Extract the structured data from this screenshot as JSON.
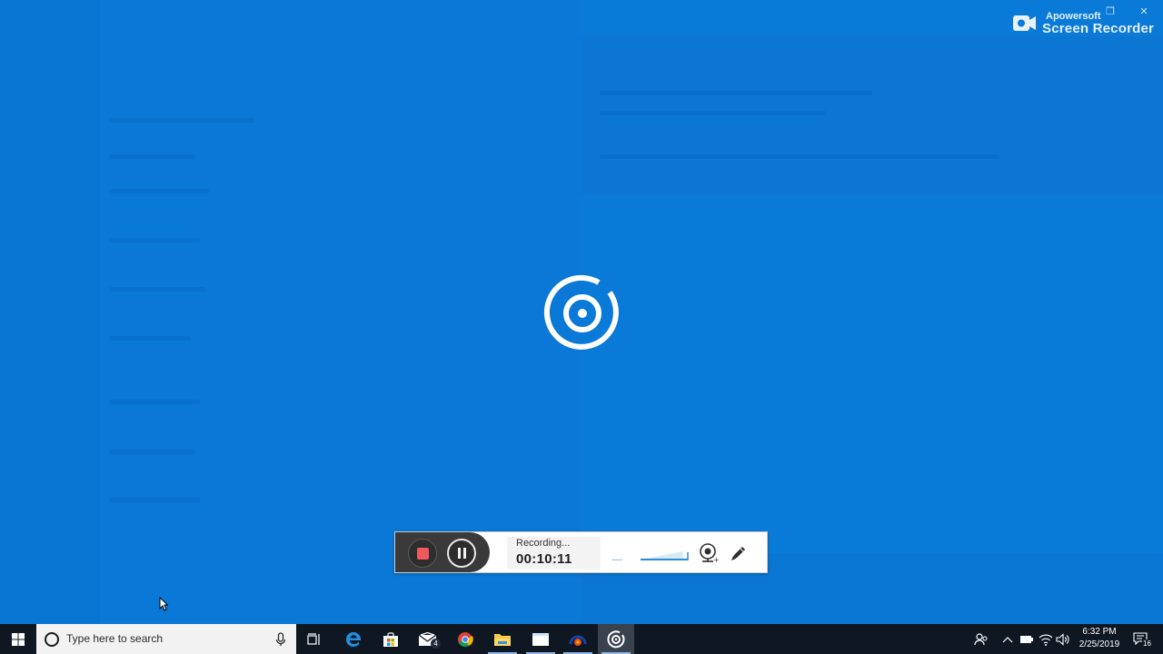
{
  "watermark": {
    "brand": "Apowersoft",
    "product": "Screen Recorder"
  },
  "recorder": {
    "status": "Recording...",
    "elapsed": "00:10:11",
    "volume_level": 0.9,
    "dots": "......"
  },
  "taskbar": {
    "search_placeholder": "Type here to search",
    "mail_badge": "4",
    "clock_time": "6:32 PM",
    "clock_date": "2/25/2019",
    "notification_count": "16"
  },
  "colors": {
    "background": "#0a7ad9",
    "taskbar": "#0f1722",
    "stop_red": "#f0595c",
    "accent": "#2a8bd8"
  },
  "icons": [
    "screen-recorder-logo-icon",
    "start-icon",
    "search-icon",
    "microphone-icon",
    "task-view-icon",
    "edge-icon",
    "store-icon",
    "mail-icon",
    "chrome-icon",
    "file-explorer-icon",
    "window-icon",
    "media-app-icon",
    "recorder-app-icon",
    "people-icon",
    "chevron-up-icon",
    "battery-icon",
    "wifi-icon",
    "volume-icon",
    "notifications-icon",
    "webcam-icon",
    "pen-icon",
    "stop-icon",
    "pause-icon"
  ]
}
